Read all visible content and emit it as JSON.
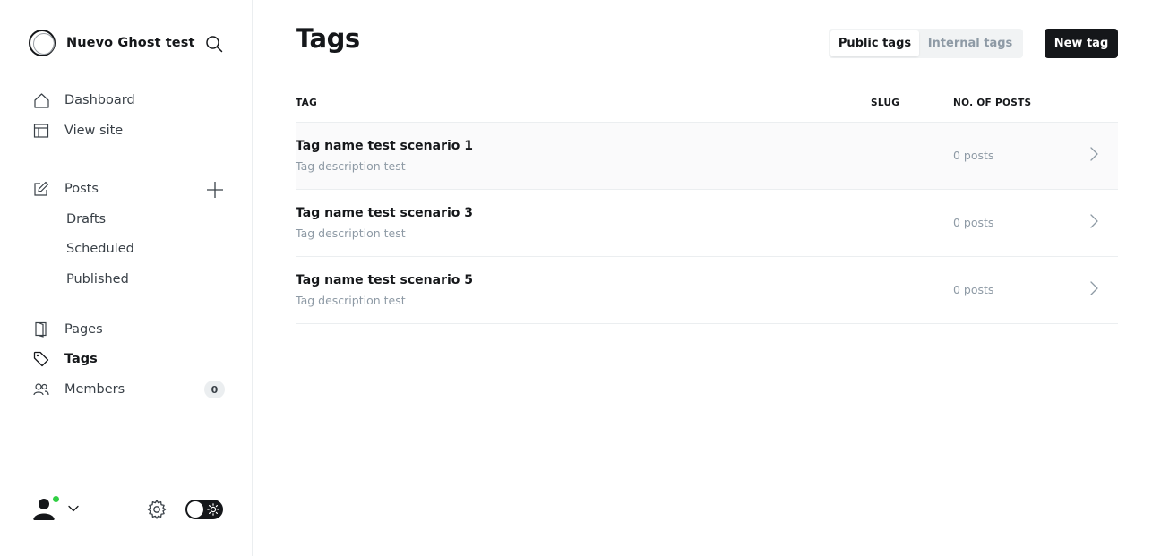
{
  "brand": {
    "name": "Nuevo Ghost test"
  },
  "nav": {
    "dashboard": "Dashboard",
    "view_site": "View site",
    "posts": "Posts",
    "drafts": "Drafts",
    "scheduled": "Scheduled",
    "published": "Published",
    "pages": "Pages",
    "tags": "Tags",
    "members": "Members",
    "members_count": "0"
  },
  "header": {
    "title": "Tags",
    "public_tags": "Public tags",
    "internal_tags": "Internal tags",
    "new_tag": "New tag"
  },
  "table": {
    "columns": {
      "tag": "TAG",
      "slug": "SLUG",
      "posts": "NO. OF POSTS"
    },
    "rows": [
      {
        "name": "Tag name test scenario 1",
        "description": "Tag description test",
        "slug": "",
        "posts": "0 posts"
      },
      {
        "name": "Tag name test scenario 3",
        "description": "Tag description test",
        "slug": "",
        "posts": "0 posts"
      },
      {
        "name": "Tag name test scenario 5",
        "description": "Tag description test",
        "slug": "",
        "posts": "0 posts"
      }
    ]
  },
  "colors": {
    "accent": "#15171a",
    "online": "#30cf43",
    "muted": "#8e9aa5"
  }
}
